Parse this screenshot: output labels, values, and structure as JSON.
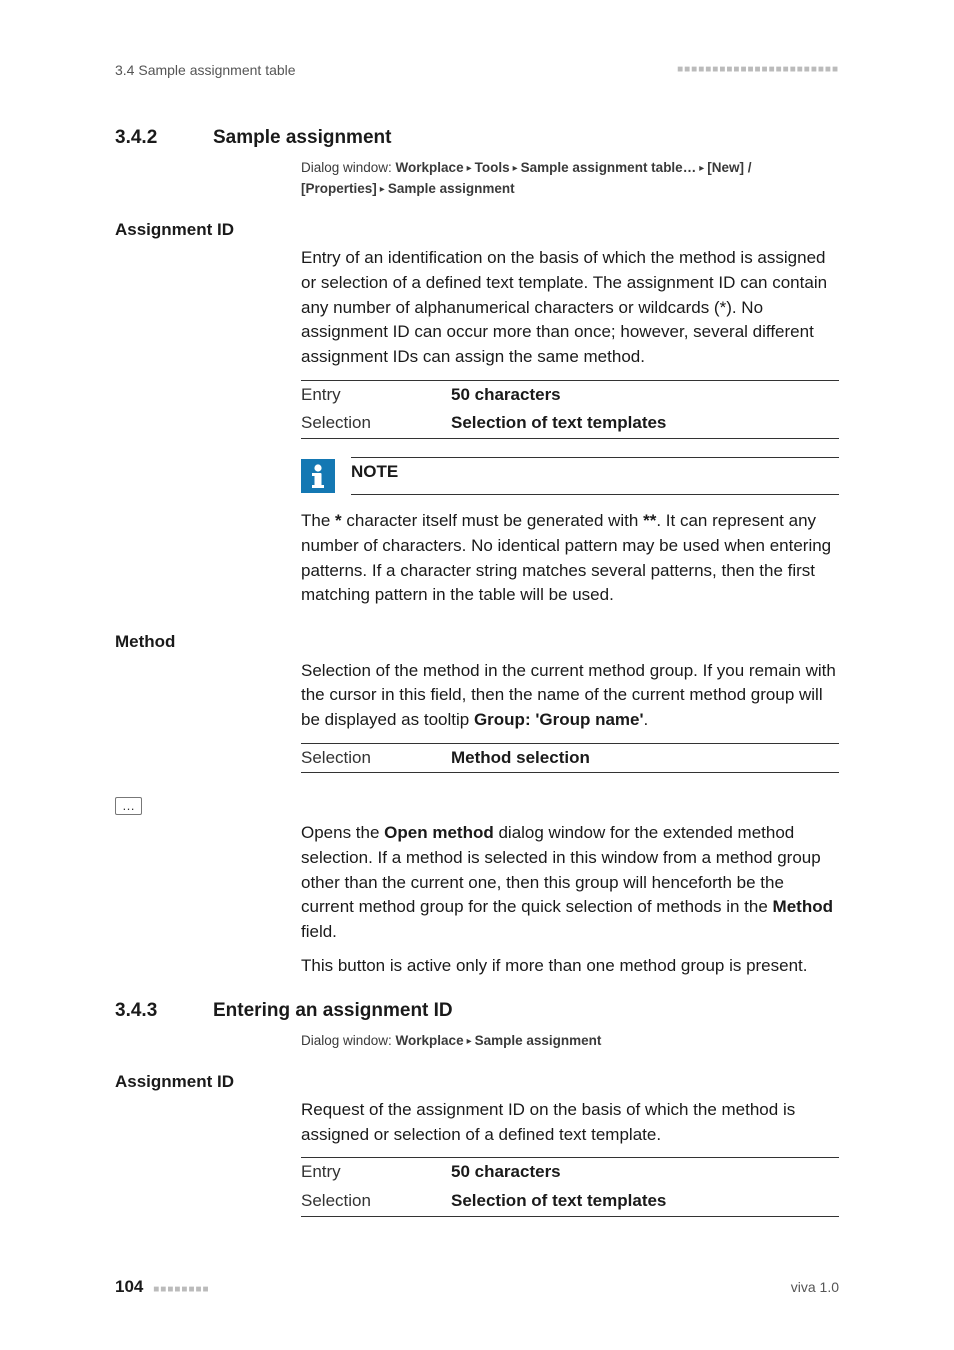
{
  "running_head": {
    "left": "3.4 Sample assignment table",
    "squares": "■■■■■■■■■■■■■■■■■■■■■■■"
  },
  "section_342": {
    "number": "3.4.2",
    "title": "Sample assignment",
    "dialog_prefix": "Dialog window: ",
    "dialog_parts": [
      "Workplace",
      "Tools",
      "Sample assignment table…",
      "[New] / [Properties]",
      "Sample assignment"
    ],
    "assignment_id": {
      "heading": "Assignment ID",
      "para": "Entry of an identification on the basis of which the method is assigned or selection of a defined text template. The assignment ID can contain any number of alphanumerical characters or wildcards (*). No assignment ID can occur more than once; however, several different assignment IDs can assign the same method.",
      "rows": [
        {
          "k": "Entry",
          "v": "50 characters"
        },
        {
          "k": "Selection",
          "v": "Selection of text templates"
        }
      ]
    },
    "note": {
      "label": "NOTE",
      "body_before": "The ",
      "body_bold1": "*",
      "body_mid1": " character itself must be generated with ",
      "body_bold2": "**",
      "body_after": ". It can represent any number of characters. No identical pattern may be used when entering patterns. If a character string matches several patterns, then the first matching pattern in the table will be used."
    },
    "method": {
      "heading": "Method",
      "para_before": "Selection of the method in the current method group. If you remain with the cursor in this field, then the name of the current method group will be displayed as tooltip ",
      "para_bold": "Group: 'Group name'",
      "para_after": ".",
      "rows": [
        {
          "k": "Selection",
          "v": "Method selection"
        }
      ],
      "btn_label": "…",
      "open_before": "Opens the ",
      "open_bold1": "Open method",
      "open_mid": " dialog window for the extended method selection. If a method is selected in this window from a method group other than the current one, then this group will henceforth be the current method group for the quick selection of methods in the ",
      "open_bold2": "Method",
      "open_after": " field.",
      "open_p2": "This button is active only if more than one method group is present."
    }
  },
  "section_343": {
    "number": "3.4.3",
    "title": "Entering an assignment ID",
    "dialog_prefix": "Dialog window: ",
    "dialog_parts": [
      "Workplace",
      "Sample assignment"
    ],
    "assignment_id": {
      "heading": "Assignment ID",
      "para": "Request of the assignment ID on the basis of which the method is assigned or selection of a defined text template.",
      "rows": [
        {
          "k": "Entry",
          "v": "50 characters"
        },
        {
          "k": "Selection",
          "v": "Selection of text templates"
        }
      ]
    }
  },
  "footer": {
    "page": "104",
    "squares": "■■■■■■■■",
    "version": "viva 1.0"
  }
}
